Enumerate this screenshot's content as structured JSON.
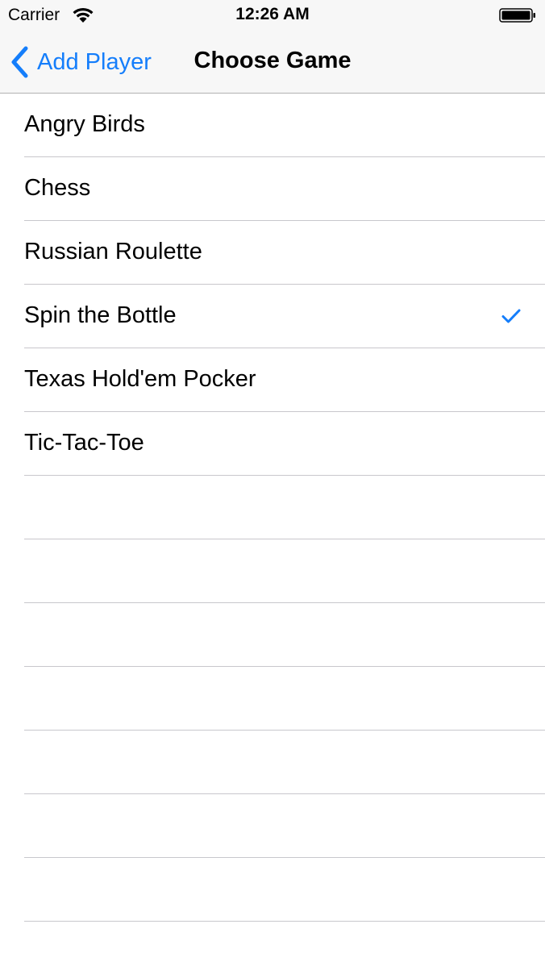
{
  "status_bar": {
    "carrier": "Carrier",
    "time": "12:26 AM",
    "icons": [
      "wifi-icon",
      "battery-icon"
    ]
  },
  "nav": {
    "back_label": "Add Player",
    "title": "Choose Game"
  },
  "games": [
    {
      "label": "Angry Birds",
      "selected": false
    },
    {
      "label": "Chess",
      "selected": false
    },
    {
      "label": "Russian Roulette",
      "selected": false
    },
    {
      "label": "Spin the Bottle",
      "selected": true
    },
    {
      "label": "Texas Hold'em Pocker",
      "selected": false
    },
    {
      "label": "Tic-Tac-Toe",
      "selected": false
    }
  ],
  "empty_rows": 7,
  "colors": {
    "accent": "#157efb",
    "separator": "#c8c7cc",
    "bar_background": "#f7f7f7"
  }
}
